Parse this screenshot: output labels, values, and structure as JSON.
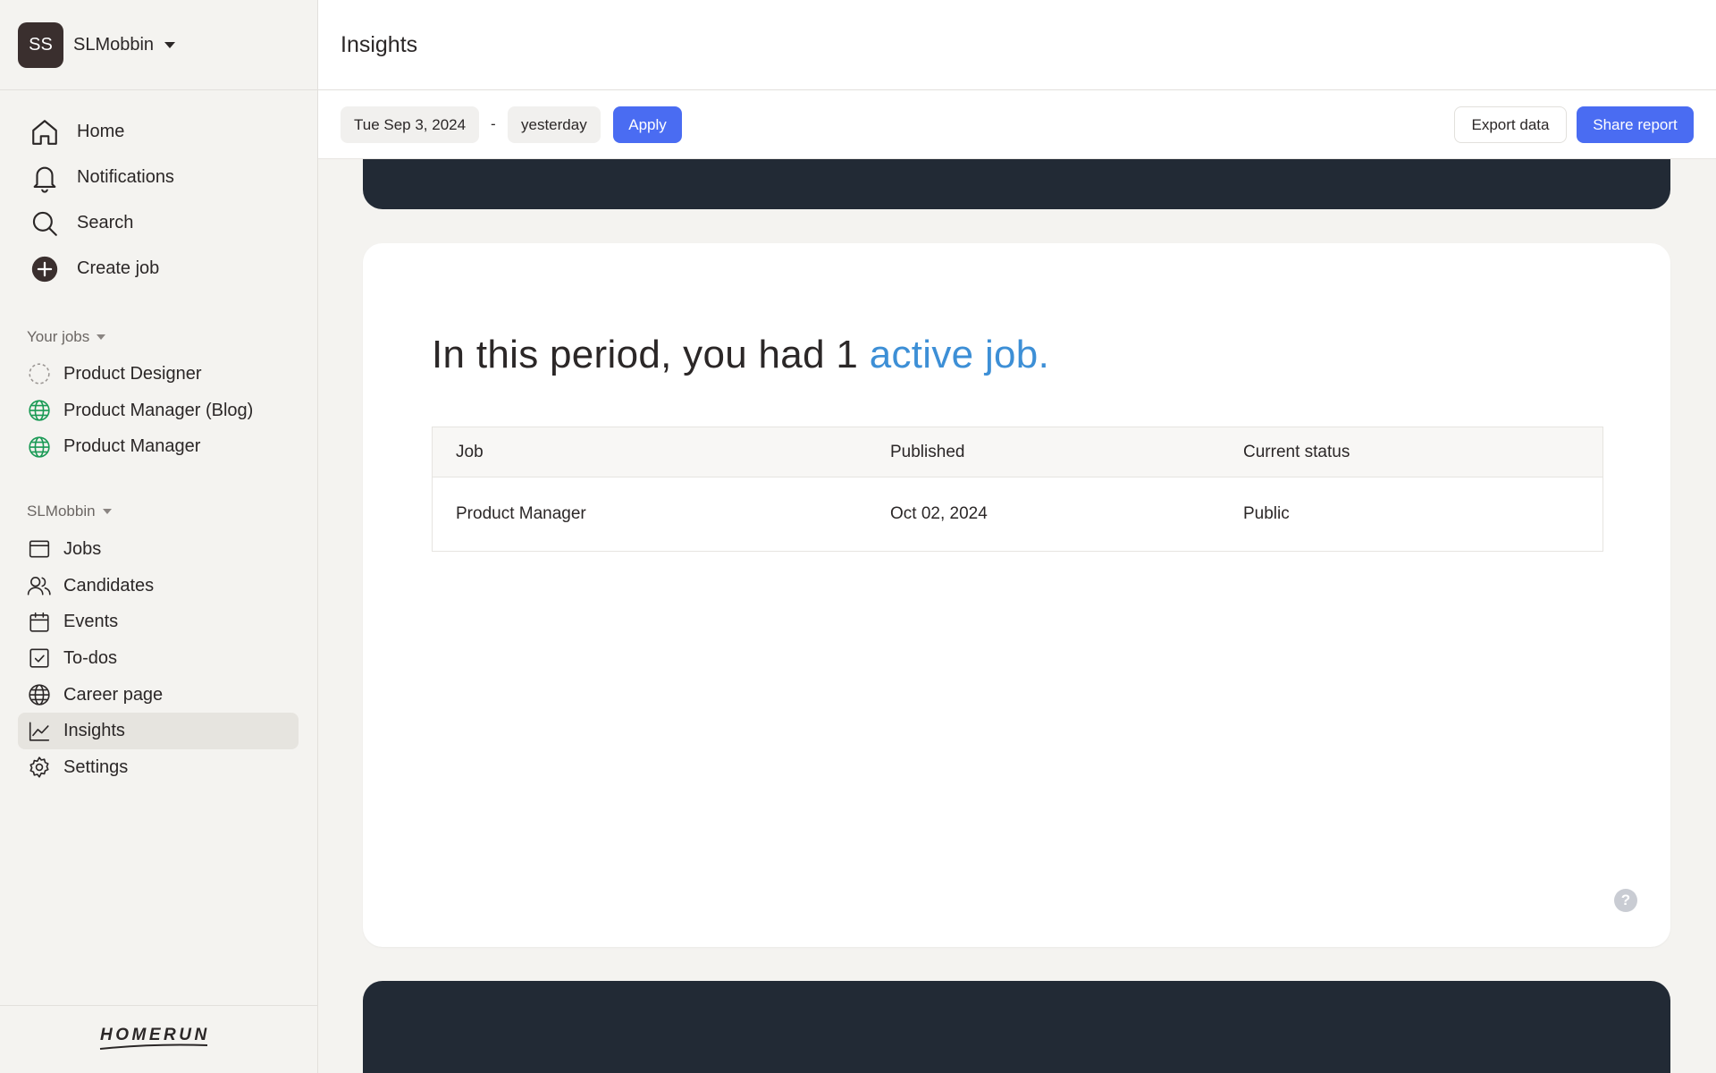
{
  "org": {
    "initials": "SS",
    "name": "SLMobbin"
  },
  "nav_main": [
    {
      "label": "Home",
      "icon": "home-icon"
    },
    {
      "label": "Notifications",
      "icon": "bell-icon"
    },
    {
      "label": "Search",
      "icon": "search-icon"
    },
    {
      "label": "Create job",
      "icon": "plus-circle-icon"
    }
  ],
  "your_jobs": {
    "label": "Your jobs",
    "items": [
      {
        "label": "Product Designer",
        "icon": "draft-circle-icon"
      },
      {
        "label": "Product Manager (Blog)",
        "icon": "globe-icon"
      },
      {
        "label": "Product Manager",
        "icon": "globe-icon"
      }
    ]
  },
  "workspace": {
    "label": "SLMobbin",
    "items": [
      {
        "label": "Jobs",
        "icon": "window-icon"
      },
      {
        "label": "Candidates",
        "icon": "users-icon"
      },
      {
        "label": "Events",
        "icon": "calendar-icon"
      },
      {
        "label": "To-dos",
        "icon": "checkbox-icon"
      },
      {
        "label": "Career page",
        "icon": "globe-icon"
      },
      {
        "label": "Insights",
        "icon": "chart-line-icon",
        "active": true
      },
      {
        "label": "Settings",
        "icon": "gear-icon"
      }
    ]
  },
  "brand": "HOMERUN",
  "header": {
    "title": "Insights"
  },
  "toolbar": {
    "date_from": "Tue Sep 3, 2024",
    "separator": "-",
    "date_to": "yesterday",
    "apply": "Apply",
    "export": "Export data",
    "share": "Share report"
  },
  "card": {
    "headline_prefix": "In this period, you had 1 ",
    "headline_highlight": "active job.",
    "columns": [
      "Job",
      "Published",
      "Current status"
    ],
    "rows": [
      {
        "job": "Product Manager",
        "published": "Oct 02, 2024",
        "status": "Public"
      }
    ],
    "help": "?"
  },
  "colors": {
    "accent": "#4a6cf2",
    "highlight": "#3d8fd6",
    "dark": "#222a35",
    "active_job_icon": "#1a9a55"
  }
}
